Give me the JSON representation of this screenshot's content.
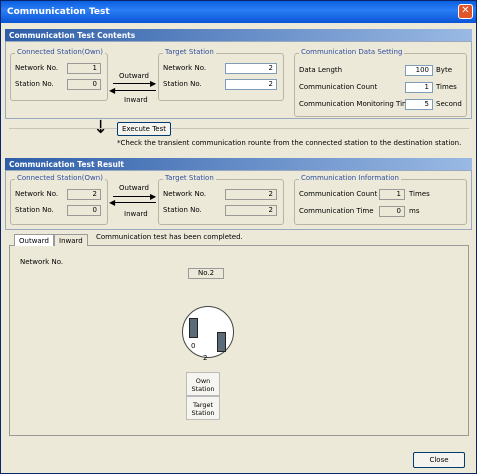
{
  "window": {
    "title": "Communication Test",
    "close_glyph": "✕"
  },
  "contents": {
    "header": "Communication Test Contents",
    "own": {
      "title": "Connected Station(Own)",
      "network_label": "Network No.",
      "network_value": "1",
      "station_label": "Station No.",
      "station_value": "0"
    },
    "outward_label": "Outward",
    "inward_label": "Inward",
    "target": {
      "title": "Target Station",
      "network_label": "Network No.",
      "network_value": "2",
      "station_label": "Station No.",
      "station_value": "2"
    },
    "setting": {
      "title": "Communication Data Setting",
      "length_label": "Data Length",
      "length_value": "100",
      "length_unit": "Byte",
      "count_label": "Communication Count",
      "count_value": "1",
      "count_unit": "Times",
      "monitor_label": "Communication Monitoring Time",
      "monitor_value": "5",
      "monitor_unit": "Second"
    }
  },
  "execute": {
    "button_label": "Execute Test",
    "note": "*Check the transient communication rounte from the connected station to the destination station."
  },
  "result": {
    "header": "Communication Test Result",
    "own": {
      "title": "Connected Station(Own)",
      "network_label": "Network No.",
      "network_value": "2",
      "station_label": "Station No.",
      "station_value": "0"
    },
    "outward_label": "Outward",
    "inward_label": "Inward",
    "target": {
      "title": "Target Station",
      "network_label": "Network No.",
      "network_value": "2",
      "station_label": "Station No.",
      "station_value": "2"
    },
    "info": {
      "title": "Communication Information",
      "count_label": "Communication Count",
      "count_value": "1",
      "count_unit": "Times",
      "time_label": "Communication Time",
      "time_value": "0",
      "time_unit": "ms"
    }
  },
  "tabs": [
    {
      "label": "Outward"
    },
    {
      "label": "Inward"
    }
  ],
  "status_message": "Communication test has been completed.",
  "diagram": {
    "network_label": "Network No.",
    "network_tag": "No.2",
    "station_a": "0",
    "station_b": "2",
    "legend_own": "Own Station",
    "legend_target": "Target Station"
  },
  "footer": {
    "close_label": "Close"
  }
}
